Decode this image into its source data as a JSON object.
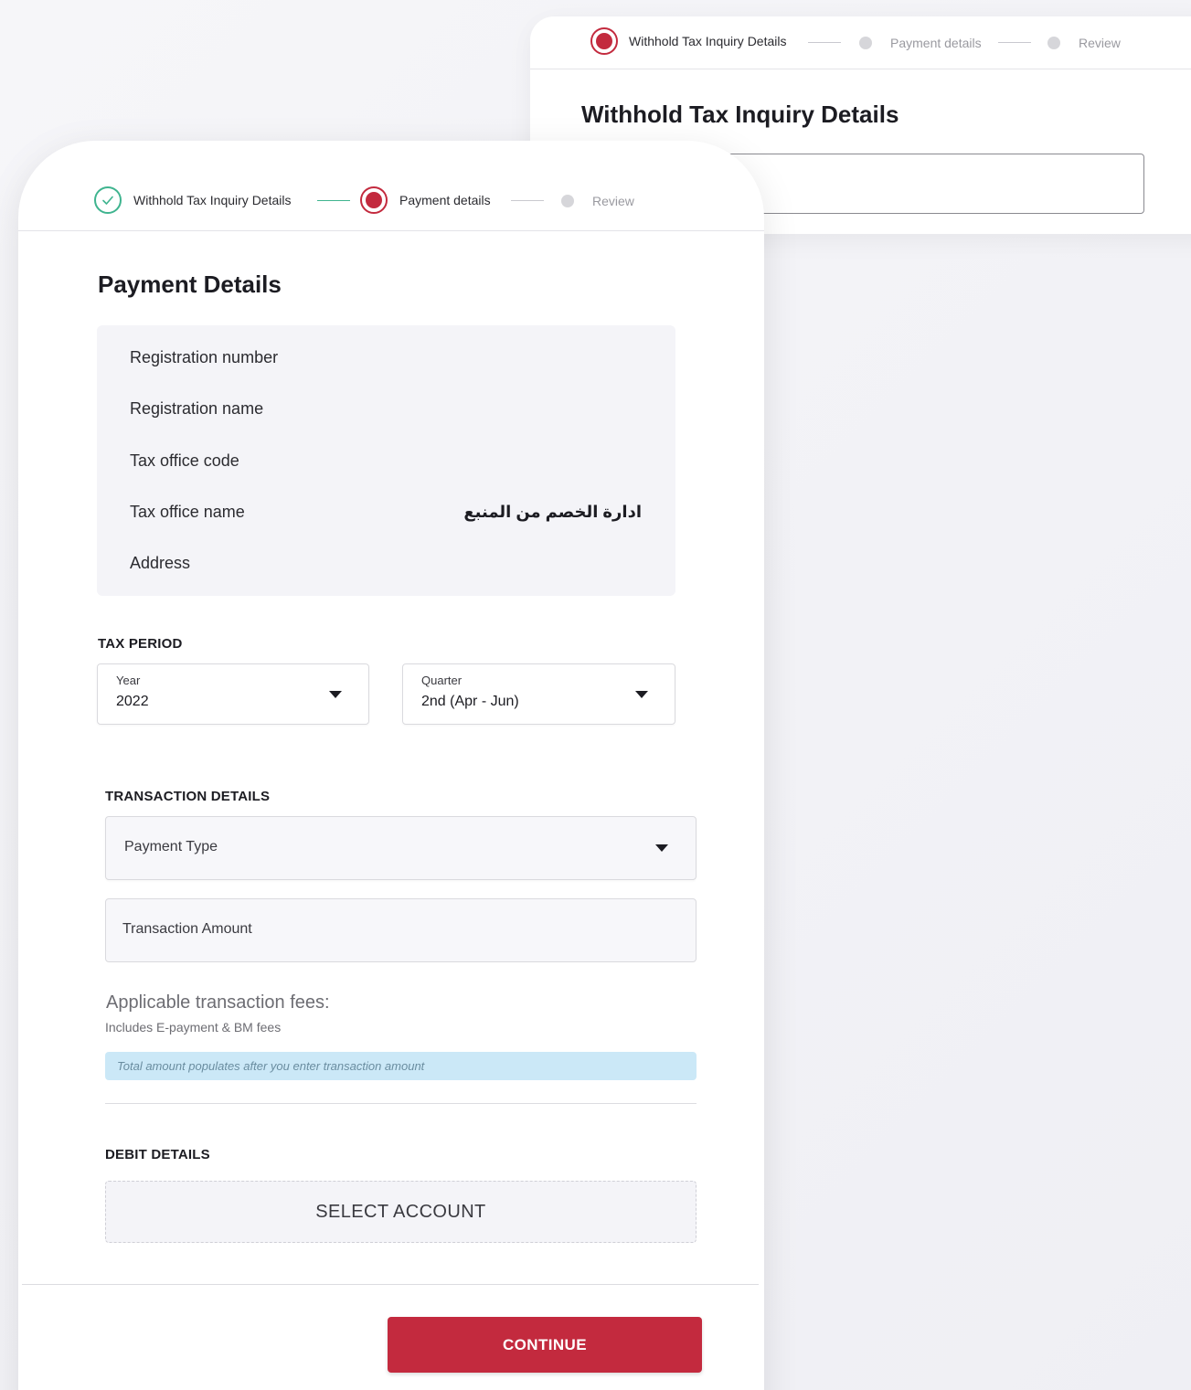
{
  "back_card": {
    "steps": [
      {
        "label": "Withhold Tax Inquiry Details",
        "state": "active"
      },
      {
        "label": "Payment details",
        "state": "pending"
      },
      {
        "label": "Review",
        "state": "pending"
      }
    ],
    "title": "Withhold Tax Inquiry Details"
  },
  "front_card": {
    "steps": [
      {
        "label": "Withhold Tax Inquiry Details",
        "state": "done"
      },
      {
        "label": "Payment details",
        "state": "active"
      },
      {
        "label": "Review",
        "state": "pending"
      }
    ],
    "title": "Payment Details",
    "info": {
      "registration_number": "Registration number",
      "registration_name": "Registration name",
      "tax_office_code": "Tax office code",
      "tax_office_name": "Tax office name",
      "tax_office_name_value": "ادارة الخصم من المنبع",
      "address": "Address"
    },
    "tax_period": {
      "heading": "TAX PERIOD",
      "year_label": "Year",
      "year_value": "2022",
      "quarter_label": "Quarter",
      "quarter_value": "2nd (Apr - Jun)"
    },
    "transaction": {
      "heading": "TRANSACTION DETAILS",
      "payment_type_placeholder": "Payment Type",
      "amount_placeholder": "Transaction Amount",
      "fees_title": "Applicable transaction fees:",
      "fees_sub": "Includes E-payment & BM fees",
      "banner_text": "Total amount populates after you enter transaction amount"
    },
    "debit": {
      "heading": "DEBIT DETAILS",
      "select_account": "SELECT ACCOUNT"
    },
    "continue_label": "CONTINUE"
  },
  "colors": {
    "accent": "#c32a3e",
    "done": "#3fb48f",
    "banner": "#cbe8f7"
  }
}
